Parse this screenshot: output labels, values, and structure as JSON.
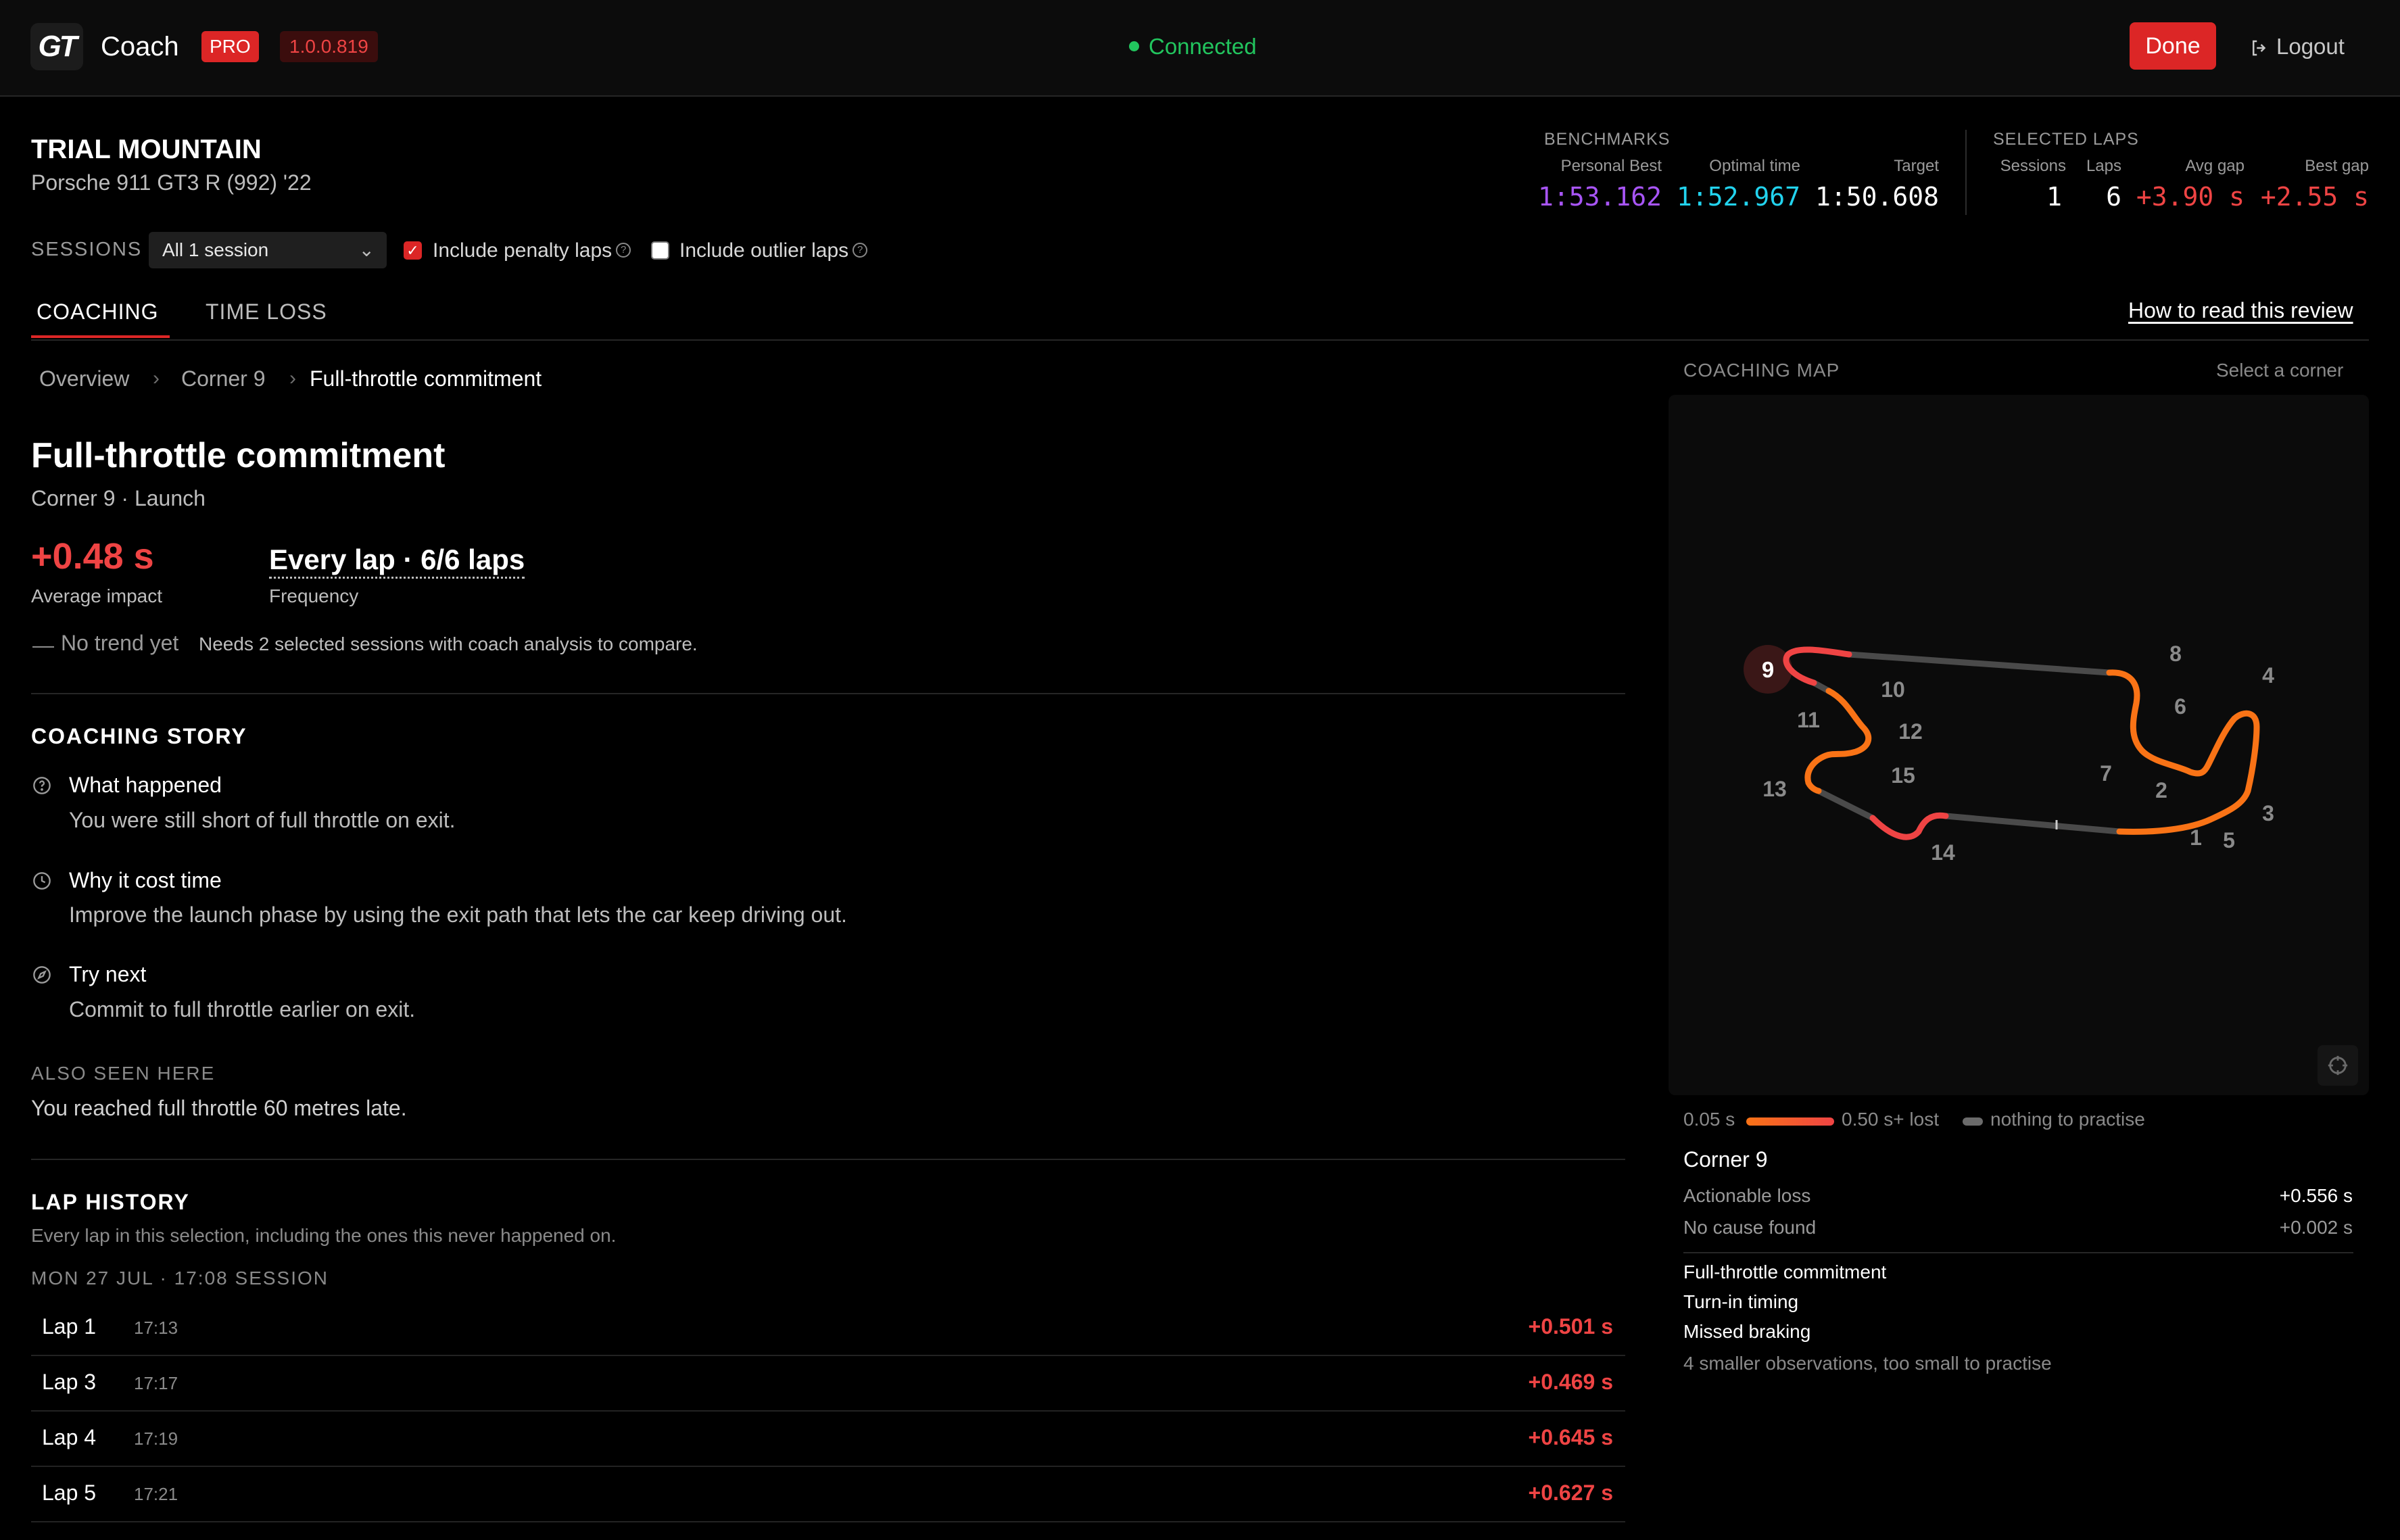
{
  "header": {
    "logo": "GT",
    "app_title": "Coach",
    "pro_badge": "PRO",
    "version": "1.0.0.819",
    "status": "Connected",
    "done_label": "Done",
    "logout_label": "Logout"
  },
  "track": {
    "name": "TRIAL MOUNTAIN",
    "car": "Porsche 911 GT3 R (992) '22"
  },
  "benchmarks": {
    "label": "BENCHMARKS",
    "personal_best_label": "Personal Best",
    "personal_best": "1:53.162",
    "optimal_label": "Optimal time",
    "optimal": "1:52.967",
    "target_label": "Target",
    "target": "1:50.608"
  },
  "selected_laps": {
    "label": "SELECTED LAPS",
    "sessions_label": "Sessions",
    "sessions": "1",
    "laps_label": "Laps",
    "laps": "6",
    "avg_gap_label": "Avg gap",
    "avg_gap": "+3.90 s",
    "best_gap_label": "Best gap",
    "best_gap": "+2.55 s"
  },
  "filters": {
    "sessions_label": "SESSIONS",
    "session_value": "All 1 session",
    "penalty_label": "Include penalty laps",
    "penalty_checked": true,
    "outlier_label": "Include outlier laps",
    "outlier_checked": false
  },
  "tabs": {
    "coaching": "COACHING",
    "time_loss": "TIME LOSS",
    "active": "coaching",
    "how_to": "How to read this review"
  },
  "breadcrumb": [
    "Overview",
    "Corner 9",
    "Full-throttle commitment"
  ],
  "issue": {
    "title": "Full-throttle commitment",
    "subtitle": "Corner 9 · Launch",
    "impact": "+0.48 s",
    "impact_label": "Average impact",
    "frequency": "Every lap · 6/6 laps",
    "frequency_label": "Frequency",
    "trend_label": "No trend yet",
    "trend_note": "Needs 2 selected sessions with coach analysis to compare."
  },
  "story": {
    "heading": "COACHING STORY",
    "items": [
      {
        "icon": "question-icon",
        "title": "What happened",
        "text": "You were still short of full throttle on exit."
      },
      {
        "icon": "clock-icon",
        "title": "Why it cost time",
        "text": "Improve the launch phase by using the exit path that lets the car keep driving out."
      },
      {
        "icon": "compass-icon",
        "title": "Try next",
        "text": "Commit to full throttle earlier on exit."
      }
    ],
    "also_label": "ALSO SEEN HERE",
    "also_text": "You reached full throttle 60 metres late."
  },
  "lap_history": {
    "heading": "LAP HISTORY",
    "description": "Every lap in this selection, including the ones this never happened on.",
    "session_label": "MON 27 JUL · 17:08 SESSION",
    "laps": [
      {
        "name": "Lap 1",
        "time": "17:13",
        "gap": "+0.501 s"
      },
      {
        "name": "Lap 3",
        "time": "17:17",
        "gap": "+0.469 s"
      },
      {
        "name": "Lap 4",
        "time": "17:19",
        "gap": "+0.645 s"
      },
      {
        "name": "Lap 5",
        "time": "17:21",
        "gap": "+0.627 s"
      }
    ]
  },
  "map": {
    "label": "COACHING MAP",
    "select_hint": "Select a corner",
    "selected_corner": "9",
    "corner_numbers": [
      "1",
      "2",
      "3",
      "4",
      "5",
      "6",
      "7",
      "8",
      "9",
      "10",
      "11",
      "12",
      "13",
      "14",
      "15"
    ],
    "colors": {
      "loss_low": "#f97316",
      "loss_high": "#ef4444",
      "neutral": "#4a4a4a"
    },
    "legend_min": "0.05 s",
    "legend_max": "0.50 s+ lost",
    "legend_none": "nothing to practise"
  },
  "corner_detail": {
    "title": "Corner 9",
    "actionable_label": "Actionable loss",
    "actionable_value": "+0.556 s",
    "nocause_label": "No cause found",
    "nocause_value": "+0.002 s",
    "observations": [
      "Full-throttle commitment",
      "Turn-in timing",
      "Missed braking"
    ],
    "smaller_note": "4 smaller observations, too small to practise"
  }
}
